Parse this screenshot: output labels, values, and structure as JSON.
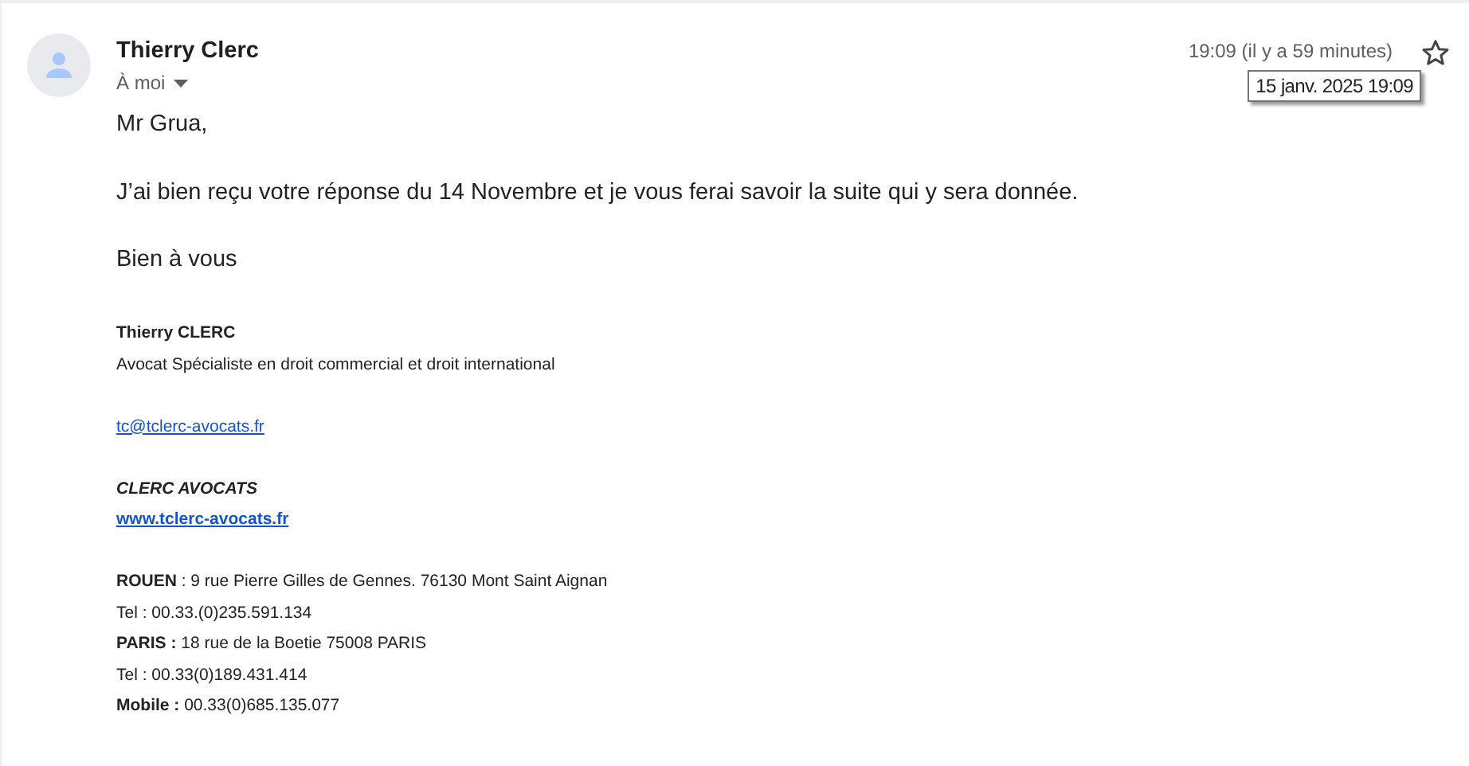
{
  "message": {
    "sender": "Thierry Clerc",
    "recipient": "À moi",
    "time": "19:09 (il y a 59 minutes)",
    "starred": false,
    "tooltip": "15 janv. 2025 19:09",
    "body": [
      "Mr Grua,",
      "J’ai bien reçu votre réponse du 14 Novembre et je vous ferai savoir la suite qui y sera donnée.",
      "Bien à vous"
    ],
    "signature": [
      [
        {
          "kind": "bold",
          "text": "Thierry CLERC"
        },
        {
          "kind": "text",
          "text": "Avocat Spécialiste en droit commercial et droit international"
        }
      ],
      [
        {
          "kind": "link",
          "text": "tc@tclerc-avocats.fr"
        }
      ],
      [
        {
          "kind": "italic-bold",
          "text": "CLERC AVOCATS"
        },
        {
          "kind": "bold-link",
          "text": "www.tclerc-avocats.fr"
        }
      ],
      [
        {
          "kind": "text",
          "text": "**ROUEN** : 9 rue Pierre Gilles de Gennes. 76130 Mont Saint Aignan"
        },
        {
          "kind": "text",
          "text": "Tel : 00.33.(0)235.591.134"
        },
        {
          "kind": "text",
          "text": "**PARIS :** 18 rue de la Boetie 75008 PARIS"
        },
        {
          "kind": "text",
          "text": "Tel : 00.33(0)189.431.414"
        },
        {
          "kind": "text",
          "text": "**Mobile :** 00.33(0)685.135.077"
        }
      ]
    ]
  }
}
